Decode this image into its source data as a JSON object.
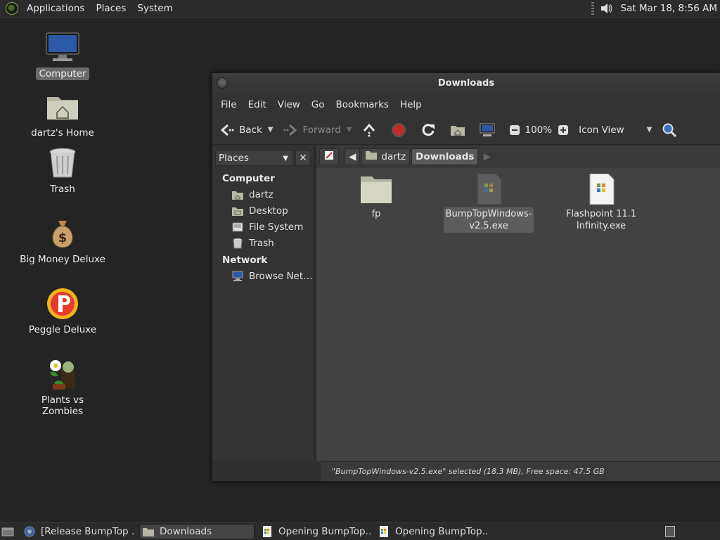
{
  "top_panel": {
    "menus": [
      "Applications",
      "Places",
      "System"
    ],
    "clock": "Sat Mar 18,  8:56 AM"
  },
  "desktop": {
    "icons": [
      {
        "label": "Computer",
        "icon": "computer-icon",
        "selected": true
      },
      {
        "label": "dartz's Home",
        "icon": "home-folder-icon"
      },
      {
        "label": "Trash",
        "icon": "trash-icon"
      },
      {
        "label": "Big Money Deluxe",
        "icon": "money-bag-icon"
      },
      {
        "label": "Peggle Deluxe",
        "icon": "peggle-icon"
      },
      {
        "label": "Plants vs Zombies",
        "icon": "plants-vs-zombies-icon"
      }
    ]
  },
  "window": {
    "title": "Downloads",
    "menubar": [
      "File",
      "Edit",
      "View",
      "Go",
      "Bookmarks",
      "Help"
    ],
    "toolbar": {
      "back": "Back",
      "forward": "Forward",
      "zoom": "100%",
      "view_mode": "Icon View"
    },
    "sidebar": {
      "selector": "Places",
      "sections": [
        {
          "title": "Computer",
          "items": [
            "dartz",
            "Desktop",
            "File System",
            "Trash"
          ]
        },
        {
          "title": "Network",
          "items": [
            "Browse Net…"
          ]
        }
      ]
    },
    "pathbar": [
      "dartz",
      "Downloads"
    ],
    "files": [
      {
        "name": "fp",
        "type": "folder"
      },
      {
        "name": "BumpTopWindows-v2.5.exe",
        "line1": "BumpTopWindows-",
        "line2": "v2.5.exe",
        "type": "exe",
        "selected": true
      },
      {
        "name": "Flashpoint 11.1 Infinity.exe",
        "line1": "Flashpoint 11.1",
        "line2": "Infinity.exe",
        "type": "exe"
      }
    ],
    "status": "\"BumpTopWindows-v2.5.exe\" selected (18.3 MB), Free space: 47.5 GB"
  },
  "taskbar": {
    "tasks": [
      "[Release BumpTop …",
      "Downloads",
      "Opening BumpTop…",
      "Opening BumpTop…"
    ],
    "active": 1
  }
}
